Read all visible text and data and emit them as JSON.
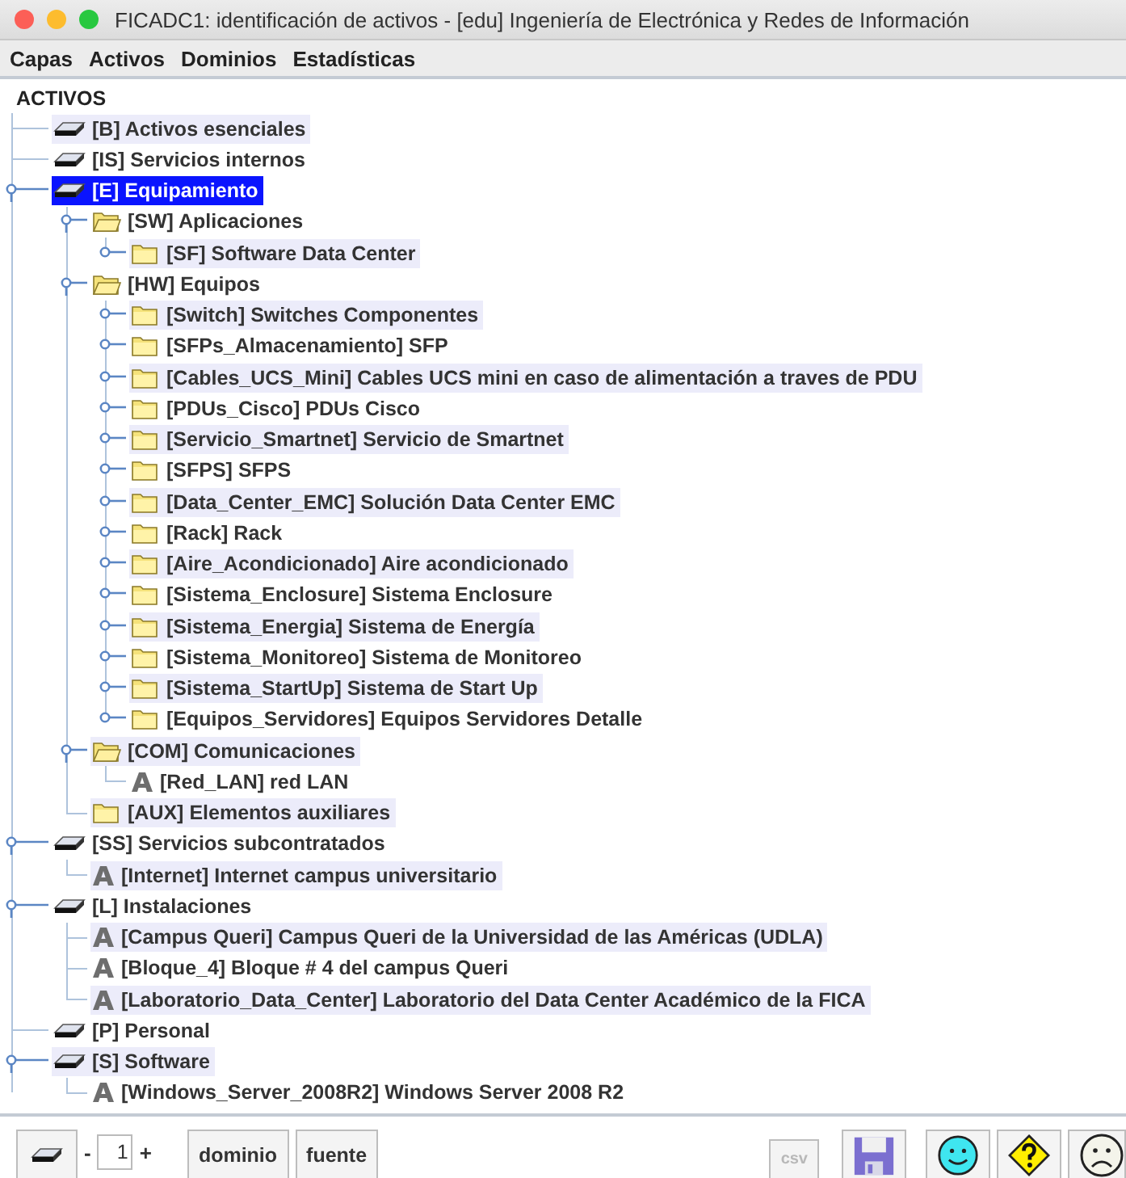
{
  "window": {
    "title": "FICADC1: identificación de activos - [edu] Ingeniería de Electrónica y Redes de Información"
  },
  "menu": [
    "Capas",
    "Activos",
    "Dominios",
    "Estadísticas"
  ],
  "tree": {
    "header": "ACTIVOS",
    "nodes": [
      {
        "label": "[B] Activos esenciales",
        "kind": "layer",
        "selected": false
      },
      {
        "label": "[IS] Servicios internos",
        "kind": "layer",
        "selected": false
      },
      {
        "label": "[E] Equipamiento",
        "kind": "layer",
        "selected": true,
        "expanded": true,
        "children": [
          {
            "label": "[SW] Aplicaciones",
            "kind": "folder",
            "selected": false,
            "expanded": true,
            "children": [
              {
                "label": "[SF] Software Data Center",
                "kind": "folder",
                "selected": false,
                "expanded": false
              }
            ]
          },
          {
            "label": "[HW] Equipos",
            "kind": "folder",
            "selected": false,
            "expanded": true,
            "children": [
              {
                "label": "[Switch] Switches Componentes",
                "kind": "folder",
                "selected": false,
                "expanded": false
              },
              {
                "label": "[SFPs_Almacenamiento] SFP",
                "kind": "folder",
                "selected": false,
                "expanded": false
              },
              {
                "label": "[Cables_UCS_Mini] Cables UCS mini en caso de alimentación a traves de PDU",
                "kind": "folder",
                "selected": false,
                "expanded": false
              },
              {
                "label": "[PDUs_Cisco] PDUs Cisco",
                "kind": "folder",
                "selected": false,
                "expanded": false
              },
              {
                "label": "[Servicio_Smartnet] Servicio de Smartnet",
                "kind": "folder",
                "selected": false,
                "expanded": false
              },
              {
                "label": "[SFPS] SFPS",
                "kind": "folder",
                "selected": false,
                "expanded": false
              },
              {
                "label": "[Data_Center_EMC] Solución Data Center EMC",
                "kind": "folder",
                "selected": false,
                "expanded": false
              },
              {
                "label": "[Rack] Rack",
                "kind": "folder",
                "selected": false,
                "expanded": false
              },
              {
                "label": "[Aire_Acondicionado] Aire acondicionado",
                "kind": "folder",
                "selected": false,
                "expanded": false
              },
              {
                "label": "[Sistema_Enclosure] Sistema Enclosure",
                "kind": "folder",
                "selected": false,
                "expanded": false
              },
              {
                "label": "[Sistema_Energia] Sistema de Energía",
                "kind": "folder",
                "selected": false,
                "expanded": false
              },
              {
                "label": "[Sistema_Monitoreo] Sistema de Monitoreo",
                "kind": "folder",
                "selected": false,
                "expanded": false
              },
              {
                "label": "[Sistema_StartUp] Sistema de Start Up",
                "kind": "folder",
                "selected": false,
                "expanded": false
              },
              {
                "label": "[Equipos_Servidores] Equipos Servidores Detalle",
                "kind": "folder",
                "selected": false,
                "expanded": false
              }
            ]
          },
          {
            "label": "[COM] Comunicaciones",
            "kind": "folder",
            "selected": false,
            "expanded": true,
            "children": [
              {
                "label": "[Red_LAN] red LAN",
                "kind": "asset",
                "selected": false
              }
            ]
          },
          {
            "label": "[AUX] Elementos auxiliares",
            "kind": "folder",
            "selected": false
          }
        ]
      },
      {
        "label": "[SS] Servicios subcontratados",
        "kind": "layer",
        "selected": false,
        "expanded": true,
        "children": [
          {
            "label": "[Internet] Internet campus universitario",
            "kind": "asset",
            "selected": false
          }
        ]
      },
      {
        "label": "[L] Instalaciones",
        "kind": "layer",
        "selected": false,
        "expanded": true,
        "children": [
          {
            "label": "[Campus Queri] Campus Queri de la Universidad de las Américas (UDLA)",
            "kind": "asset",
            "selected": false
          },
          {
            "label": "[Bloque_4] Bloque # 4 del campus Queri",
            "kind": "asset",
            "selected": false
          },
          {
            "label": "[Laboratorio_Data_Center] Laboratorio del Data Center Académico de la FICA",
            "kind": "asset",
            "selected": false
          }
        ]
      },
      {
        "label": "[P] Personal",
        "kind": "layer",
        "selected": false
      },
      {
        "label": "[S] Software",
        "kind": "layer",
        "selected": false,
        "expanded": true,
        "children": [
          {
            "label": "[Windows_Server_2008R2] Windows Server 2008 R2",
            "kind": "asset",
            "selected": false
          }
        ]
      }
    ]
  },
  "toolbar": {
    "decrement": "-",
    "level_value": "1",
    "increment": "+",
    "buttons": [
      "dominio",
      "fuente"
    ],
    "csv": {
      "label": "csv",
      "disabled": true
    }
  }
}
